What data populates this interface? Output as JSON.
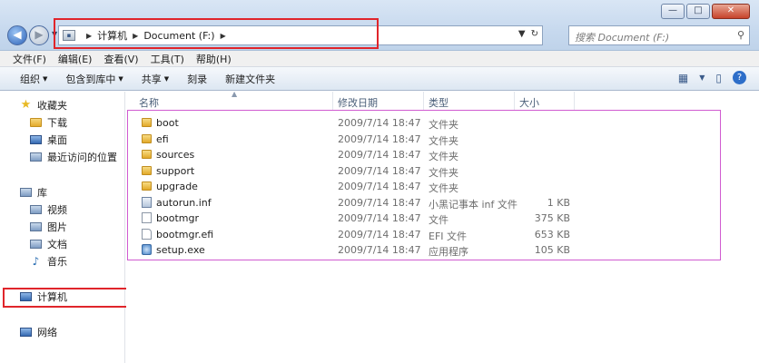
{
  "window": {
    "controls": {
      "minimize": "—",
      "maximize": "□",
      "close": "✕"
    }
  },
  "nav": {
    "back_icon": "back-arrow-icon",
    "forward_icon": "forward-arrow-icon"
  },
  "address": {
    "crumbs": [
      "计算机",
      "Document (F:)"
    ],
    "refresh_icon": "refresh-icon"
  },
  "search": {
    "placeholder": "搜索 Document (F:)"
  },
  "menubar": {
    "items": [
      "文件(F)",
      "编辑(E)",
      "查看(V)",
      "工具(T)",
      "帮助(H)"
    ]
  },
  "toolbar": {
    "organize": "组织",
    "include_library": "包含到库中",
    "share": "共享",
    "burn": "刻录",
    "new_folder": "新建文件夹"
  },
  "sidebar": {
    "favorites": "收藏夹",
    "downloads": "下载",
    "desktop": "桌面",
    "recent": "最近访问的位置",
    "libraries": "库",
    "videos": "视频",
    "pictures": "图片",
    "documents": "文档",
    "music": "音乐",
    "computer": "计算机",
    "network": "网络"
  },
  "columns": {
    "name": "名称",
    "modified": "修改日期",
    "type": "类型",
    "size": "大小"
  },
  "files": [
    {
      "name": "boot",
      "modified": "2009/7/14 18:47",
      "type": "文件夹",
      "size": "",
      "kind": "folder"
    },
    {
      "name": "efi",
      "modified": "2009/7/14 18:47",
      "type": "文件夹",
      "size": "",
      "kind": "folder"
    },
    {
      "name": "sources",
      "modified": "2009/7/14 18:47",
      "type": "文件夹",
      "size": "",
      "kind": "folder"
    },
    {
      "name": "support",
      "modified": "2009/7/14 18:47",
      "type": "文件夹",
      "size": "",
      "kind": "folder"
    },
    {
      "name": "upgrade",
      "modified": "2009/7/14 18:47",
      "type": "文件夹",
      "size": "",
      "kind": "folder"
    },
    {
      "name": "autorun.inf",
      "modified": "2009/7/14 18:47",
      "type": "小黑记事本 inf 文件",
      "size": "1 KB",
      "kind": "inf"
    },
    {
      "name": "bootmgr",
      "modified": "2009/7/14 18:47",
      "type": "文件",
      "size": "375 KB",
      "kind": "file"
    },
    {
      "name": "bootmgr.efi",
      "modified": "2009/7/14 18:47",
      "type": "EFI 文件",
      "size": "653 KB",
      "kind": "efi"
    },
    {
      "name": "setup.exe",
      "modified": "2009/7/14 18:47",
      "type": "应用程序",
      "size": "105 KB",
      "kind": "exe"
    }
  ]
}
